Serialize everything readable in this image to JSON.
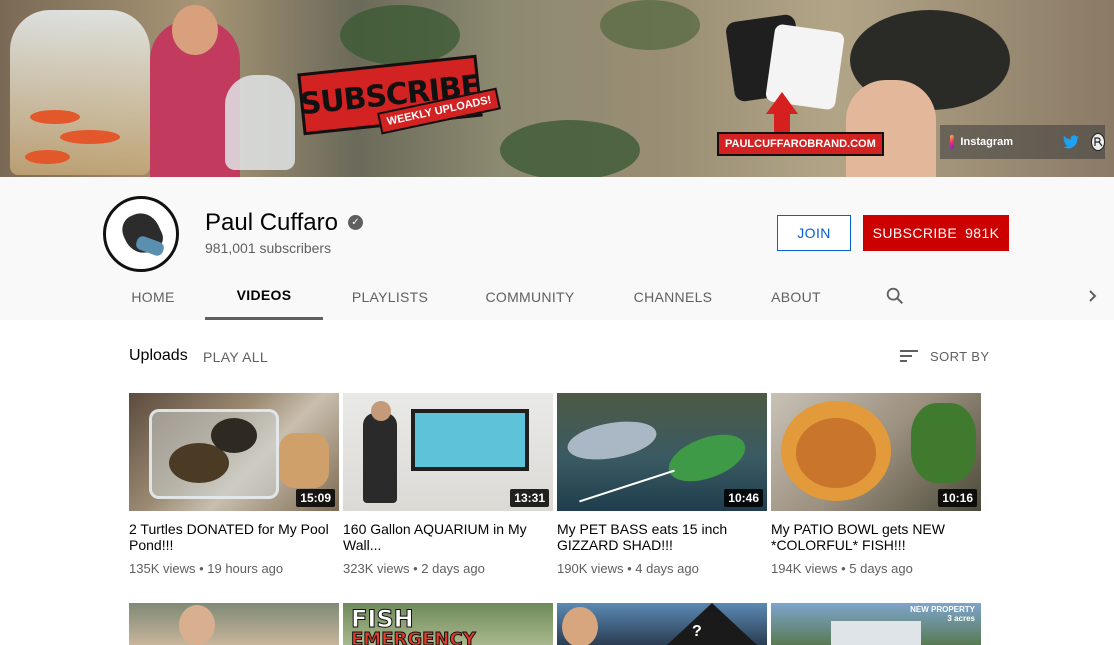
{
  "banner": {
    "subscribe_text": "SUBSCRIBE",
    "weekly_text": "WEEKLY UPLOADS!",
    "brand_url": "PAULCUFFAROBRAND.COM",
    "instagram_label": "Instagram"
  },
  "channel": {
    "name": "Paul Cuffaro",
    "subscribers": "981,001 subscribers",
    "join_label": "JOIN",
    "subscribe_label": "SUBSCRIBE",
    "subscribe_count": "981K"
  },
  "tabs": [
    {
      "label": "HOME"
    },
    {
      "label": "VIDEOS"
    },
    {
      "label": "PLAYLISTS"
    },
    {
      "label": "COMMUNITY"
    },
    {
      "label": "CHANNELS"
    },
    {
      "label": "ABOUT"
    }
  ],
  "uploads": {
    "title": "Uploads",
    "play_all": "PLAY ALL",
    "sort_by": "SORT BY"
  },
  "videos": [
    {
      "title": "2 Turtles DONATED for My Pool Pond!!!",
      "duration": "15:09",
      "meta": "135K views • 19 hours ago"
    },
    {
      "title": "160 Gallon AQUARIUM in My Wall...",
      "duration": "13:31",
      "meta": "323K views • 2 days ago"
    },
    {
      "title": "My PET BASS eats 15 inch GIZZARD SHAD!!!",
      "duration": "10:46",
      "meta": "190K views • 4 days ago"
    },
    {
      "title": "My PATIO BOWL gets NEW *COLORFUL* FISH!!!",
      "duration": "10:16",
      "meta": "194K views • 5 days ago"
    }
  ],
  "row2": {
    "fish_text_1": "FISH",
    "fish_text_2": "EMERGENCY",
    "question_mark": "?",
    "property_text_1": "NEW PROPERTY",
    "property_text_2": "3 acres"
  },
  "colors": {
    "subscribe_red": "#cc0000",
    "join_blue": "#065fd4",
    "header_bg": "#f9f9f9"
  }
}
